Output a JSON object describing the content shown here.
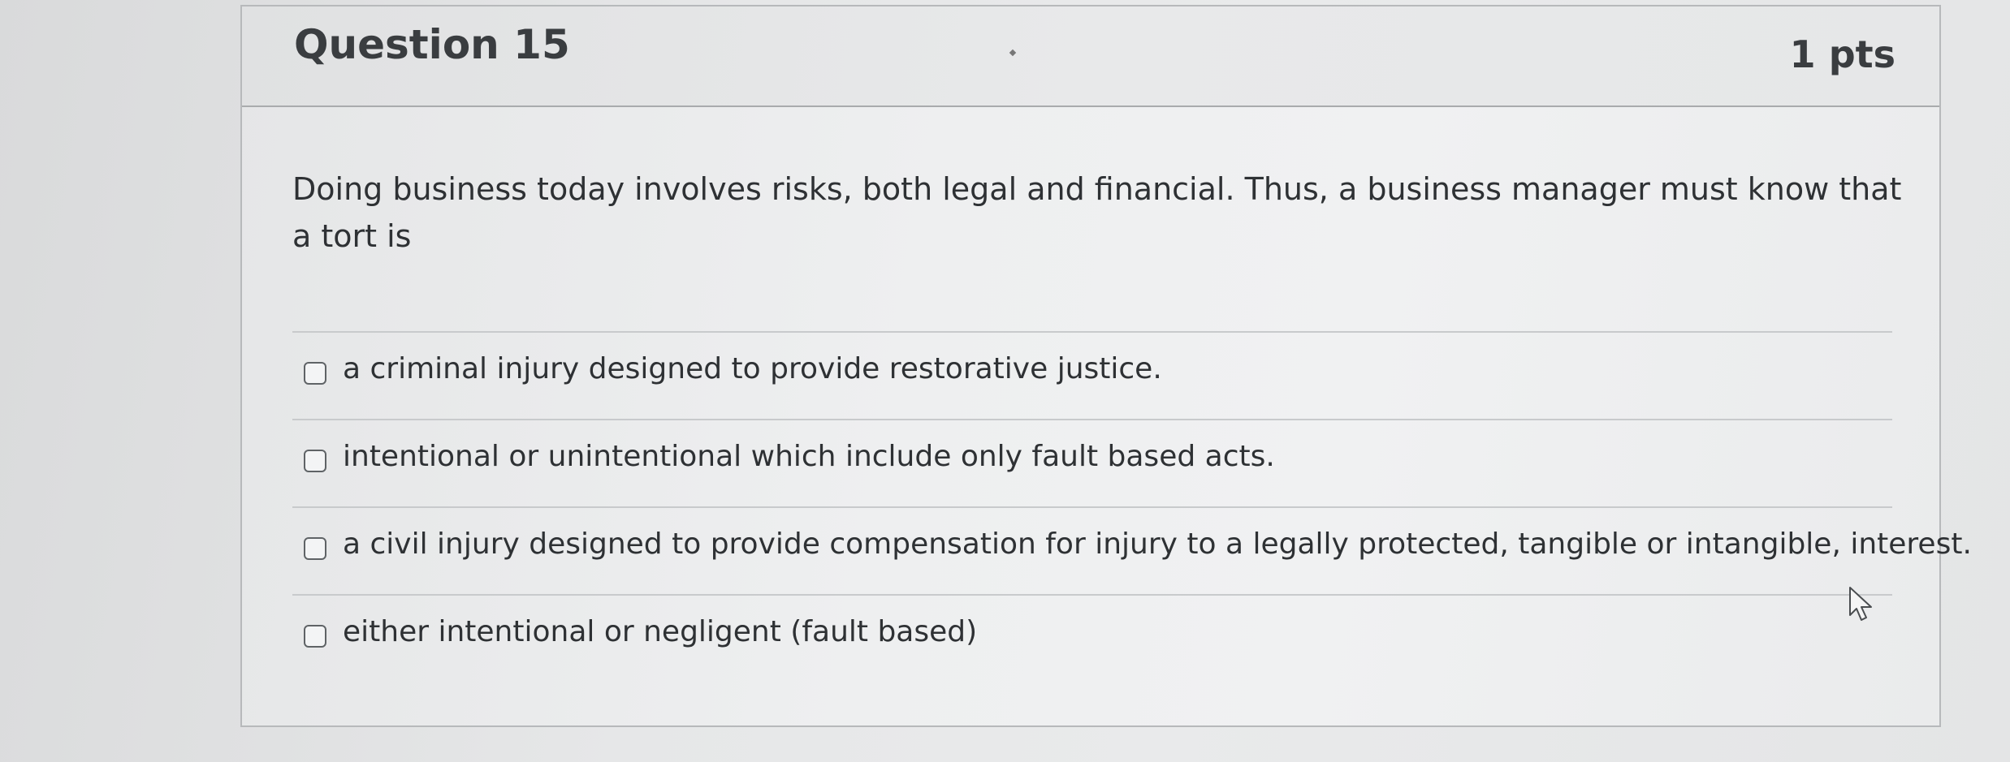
{
  "question": {
    "title": "Question 15",
    "points": "1 pts",
    "stem": "Doing business today involves risks, both legal and financial. Thus, a business manager must know that a tort is"
  },
  "answers": [
    {
      "label": "a criminal injury designed to provide restorative justice.",
      "checked": false
    },
    {
      "label": "intentional or unintentional which include only fault based acts.",
      "checked": false
    },
    {
      "label": "a civil injury designed to provide compensation for injury to a legally protected, tangible or intangible, interest.",
      "checked": false
    },
    {
      "label": "either intentional or negligent (fault based)",
      "checked": false
    }
  ],
  "icons": {
    "checkbox": "checkbox-icon",
    "cursor": "mouse-pointer-icon"
  }
}
